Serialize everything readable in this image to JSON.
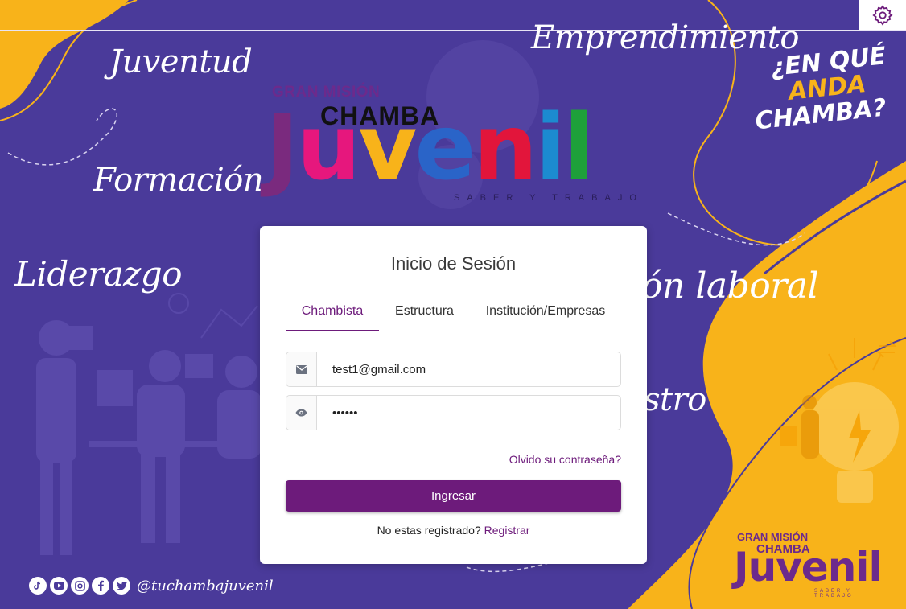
{
  "background": {
    "words": {
      "juventud": "Juventud",
      "emprendimiento": "Emprendimiento",
      "formacion": "Formación",
      "liderazgo": "Liderazgo",
      "insercion_laboral": "ón laboral",
      "registro": "stro"
    },
    "slogan": {
      "line1": "¿EN QUÉ",
      "line2": "ANDA",
      "line3": "CHAMBA?"
    },
    "logo": {
      "gran_mision": "GRAN MISIÓN",
      "chamba": "CHAMBA",
      "juvenil": "Juvenil",
      "tagline": "SABER Y TRABAJO"
    },
    "logo_small": {
      "gran_mision": "GRAN MISIÓN",
      "chamba": "CHAMBA",
      "juvenil": "Juvenil",
      "tagline": "SABER Y TRABAJO"
    },
    "social": {
      "handle": "@tuchambajuvenil",
      "icons": [
        "tiktok-icon",
        "youtube-icon",
        "instagram-icon",
        "facebook-icon",
        "twitter-icon"
      ]
    },
    "colors": {
      "purple_bg": "#4a3a9a",
      "yellow": "#f8b31a",
      "brand_purple": "#6d1b7b"
    }
  },
  "header": {
    "settings_icon": "gear-icon"
  },
  "login": {
    "title": "Inicio de Sesión",
    "tabs": [
      {
        "label": "Chambista",
        "active": true
      },
      {
        "label": "Estructura",
        "active": false
      },
      {
        "label": "Institución/Empresas",
        "active": false
      }
    ],
    "email": {
      "value": "test1@gmail.com",
      "icon": "envelope-icon"
    },
    "password": {
      "value": "••••••",
      "icon": "eye-icon"
    },
    "forgot_link": "Olvido su contraseña?",
    "submit_label": "Ingresar",
    "register_prompt": "No estas registrado?",
    "register_link": "Registrar"
  }
}
